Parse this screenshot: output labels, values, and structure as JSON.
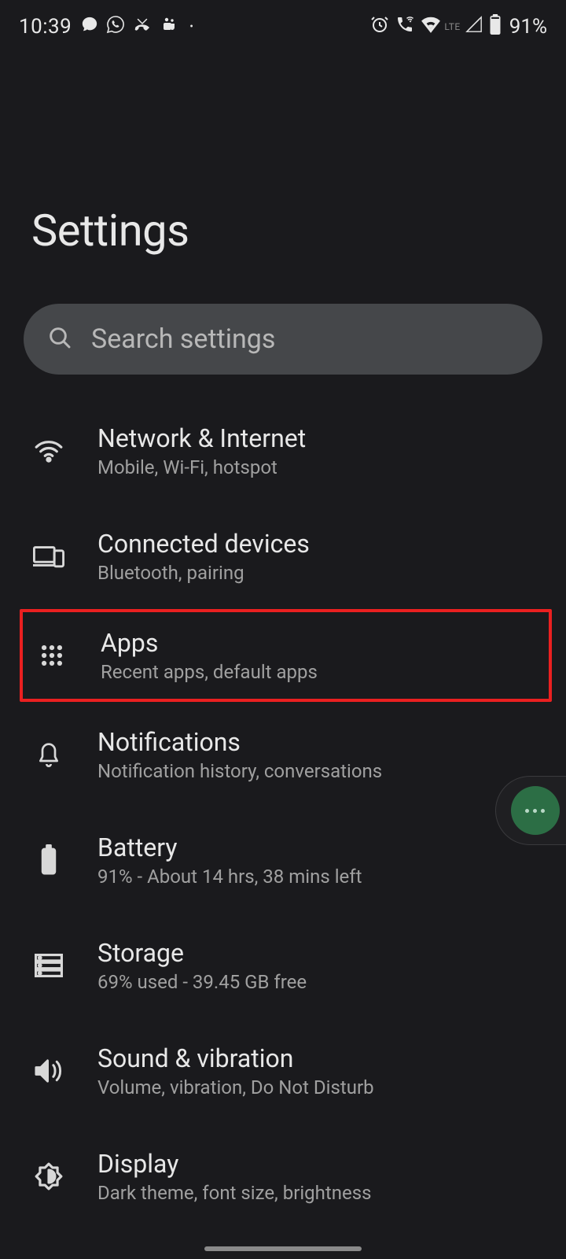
{
  "status": {
    "time": "10:39",
    "battery": "91%"
  },
  "page": {
    "title": "Settings"
  },
  "search": {
    "placeholder": "Search settings"
  },
  "items": [
    {
      "title": "Network & Internet",
      "subtitle": "Mobile, Wi-Fi, hotspot"
    },
    {
      "title": "Connected devices",
      "subtitle": "Bluetooth, pairing"
    },
    {
      "title": "Apps",
      "subtitle": "Recent apps, default apps"
    },
    {
      "title": "Notifications",
      "subtitle": "Notification history, conversations"
    },
    {
      "title": "Battery",
      "subtitle": "91% - About 14 hrs, 38 mins left"
    },
    {
      "title": "Storage",
      "subtitle": "69% used - 39.45 GB free"
    },
    {
      "title": "Sound & vibration",
      "subtitle": "Volume, vibration, Do Not Disturb"
    },
    {
      "title": "Display",
      "subtitle": "Dark theme, font size, brightness"
    }
  ]
}
